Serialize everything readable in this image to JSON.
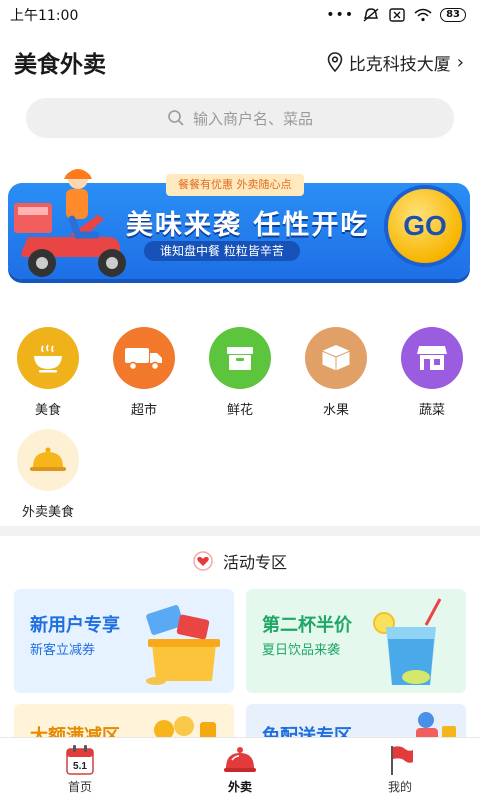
{
  "status": {
    "time": "上午11:00",
    "battery": "83"
  },
  "header": {
    "title": "美食外卖",
    "location": "比克科技大厦"
  },
  "search": {
    "placeholder": "输入商户名、菜品"
  },
  "banner": {
    "tag": "餐餐有优惠  外卖随心点",
    "title": "美味来袭  任性开吃",
    "subtitle": "谁知盘中餐 粒粒皆辛苦",
    "go": "GO"
  },
  "categories": [
    {
      "label": "美食",
      "color": "#f0b21b",
      "icon": "bowl-icon"
    },
    {
      "label": "超市",
      "color": "#f2782b",
      "icon": "truck-icon"
    },
    {
      "label": "鲜花",
      "color": "#5cc43d",
      "icon": "box-icon"
    },
    {
      "label": "水果",
      "color": "#e0a066",
      "icon": "open-box-icon"
    },
    {
      "label": "蔬菜",
      "color": "#9b5de0",
      "icon": "store-icon"
    },
    {
      "label": "外卖美食",
      "color": "#fdf0d4",
      "icon": "dish-cover-icon"
    }
  ],
  "activity": {
    "title": "活动专区",
    "cards": [
      {
        "title": "新用户专享",
        "subtitle": "新客立减券",
        "bg": "#e6f2ff",
        "color": "#1f6fe0"
      },
      {
        "title": "第二杯半价",
        "subtitle": "夏日饮品来袭",
        "bg": "#e4f8ee",
        "color": "#1fa765"
      },
      {
        "title": "大额满减区",
        "subtitle": "",
        "bg": "#fff4d9",
        "color": "#e68a00"
      },
      {
        "title": "免配送专区",
        "subtitle": "",
        "bg": "#e8f1fb",
        "color": "#1f6fe0"
      }
    ]
  },
  "nav": {
    "home": "首页",
    "takeout": "外卖",
    "mine": "我的",
    "calendar_text": "5.1"
  }
}
